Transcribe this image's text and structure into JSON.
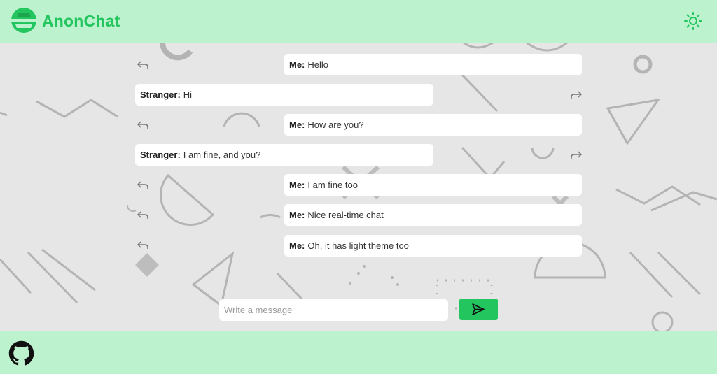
{
  "header": {
    "brand": "AnonChat",
    "logo_icon": "incognito-icon",
    "theme_icon": "sun-icon",
    "accent": "#22c55e",
    "bar_color": "#bdf2cf"
  },
  "messages": [
    {
      "sender": "Me:",
      "text": "Hello",
      "side": "me"
    },
    {
      "sender": "Stranger:",
      "text": "Hi",
      "side": "stranger"
    },
    {
      "sender": "Me:",
      "text": "How are you?",
      "side": "me"
    },
    {
      "sender": "Stranger:",
      "text": "I am fine, and you?",
      "side": "stranger"
    },
    {
      "sender": "Me:",
      "text": "I am fine too",
      "side": "me"
    },
    {
      "sender": "Me:",
      "text": "Nice real-time chat",
      "side": "me"
    },
    {
      "sender": "Me:",
      "text": "Oh, it has light theme too",
      "side": "me"
    }
  ],
  "composer": {
    "placeholder": "Write a message",
    "value": "",
    "send_icon": "send-icon"
  },
  "footer": {
    "link_icon": "github-icon"
  }
}
